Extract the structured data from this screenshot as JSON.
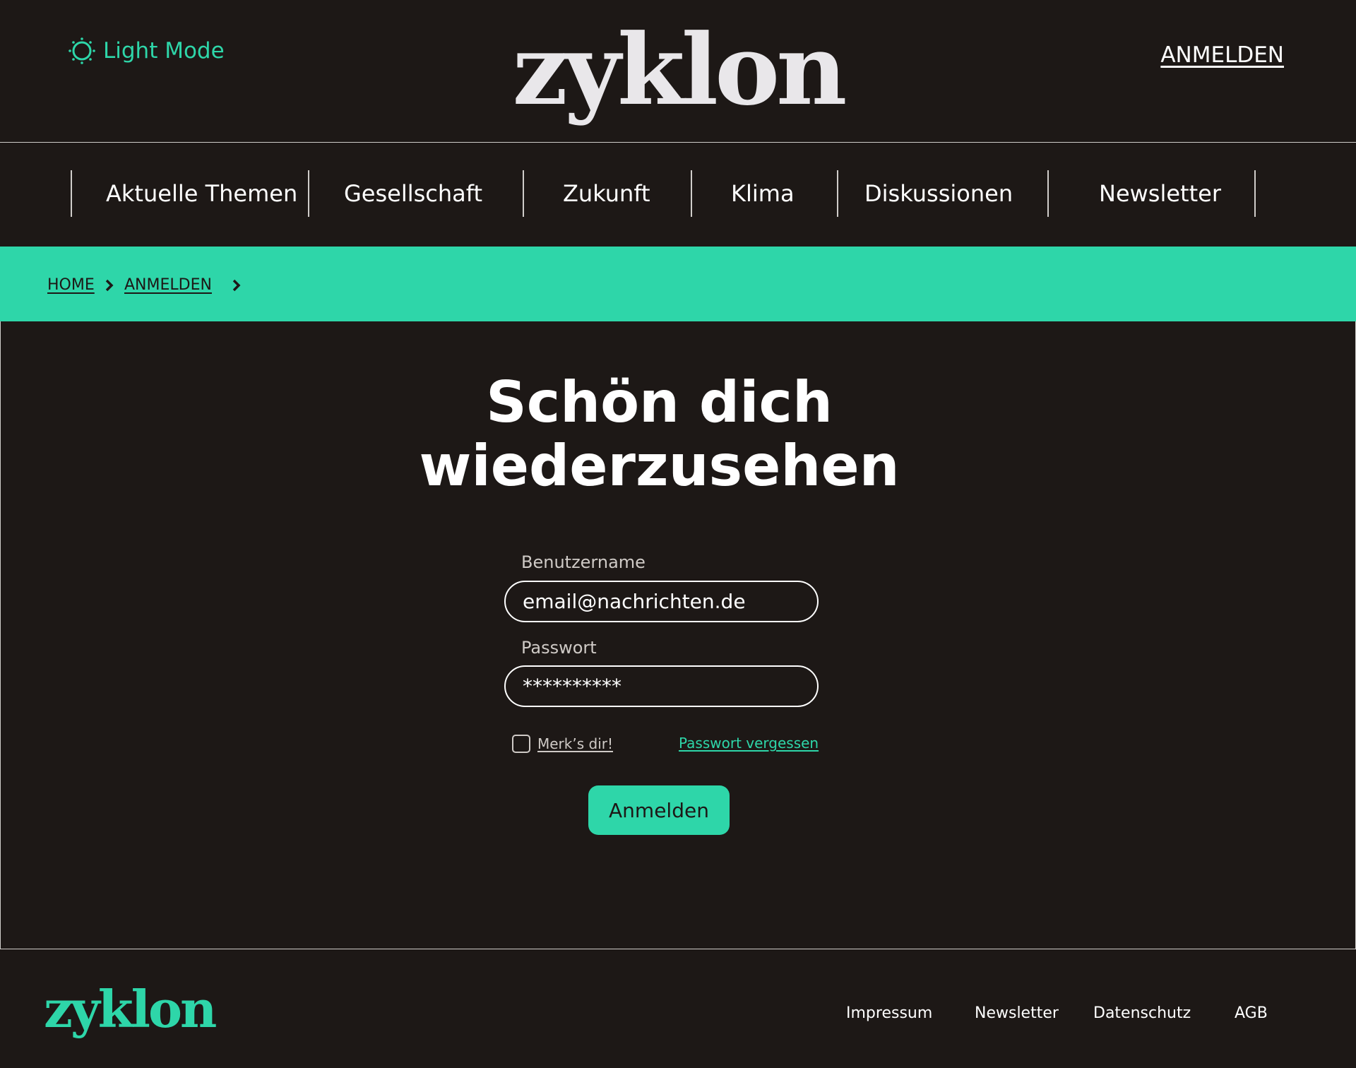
{
  "colors": {
    "background": "#1d1816",
    "accent": "#2ed6a9",
    "text": "#ffffff",
    "muted_text": "#cfcac6",
    "divider": "#d0cdca"
  },
  "header": {
    "theme_toggle": {
      "icon": "sun-icon",
      "label": "Light Mode"
    },
    "logo": "zyklon",
    "login_link": "ANMELDEN"
  },
  "nav": {
    "items": [
      {
        "label": "Aktuelle Themen"
      },
      {
        "label": "Gesellschaft"
      },
      {
        "label": "Zukunft"
      },
      {
        "label": "Klima"
      },
      {
        "label": "Diskussionen"
      },
      {
        "label": "Newsletter"
      }
    ]
  },
  "breadcrumb": {
    "items": [
      {
        "label": "HOME"
      },
      {
        "label": "ANMELDEN"
      }
    ],
    "separator_icon": "chevron-right-icon"
  },
  "login": {
    "headline_line1": "Schön dich",
    "headline_line2": "wiederzusehen",
    "username_label": "Benutzername",
    "username_value": "email@nachrichten.de",
    "password_label": "Passwort",
    "password_value": "**********",
    "remember_label": "Merk’s dir!",
    "remember_checked": false,
    "forgot_label": "Passwort vergessen",
    "submit_label": "Anmelden"
  },
  "footer": {
    "logo": "zyklon",
    "links": [
      {
        "label": "Impressum"
      },
      {
        "label": "Newsletter"
      },
      {
        "label": "Datenschutz"
      },
      {
        "label": "AGB"
      }
    ]
  }
}
